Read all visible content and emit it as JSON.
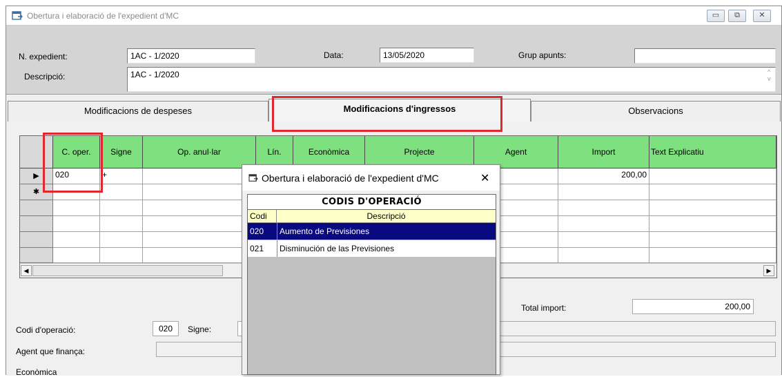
{
  "window": {
    "title": "Obertura i elaboració de l'expedient d'MC",
    "buttons": {
      "minimize": "▭",
      "restore": "⧉",
      "close": "✕"
    }
  },
  "header": {
    "expedient_label": "N. expedient:",
    "expedient_value": "1AC - 1/2020",
    "data_label": "Data:",
    "data_value": "13/05/2020",
    "grup_label": "Grup apunts:",
    "grup_value": "",
    "descripcio_label": "Descripció:",
    "descripcio_value": "1AC - 1/2020"
  },
  "tabs": [
    {
      "label": "Modificacions de despeses",
      "active": false
    },
    {
      "label": "Modificacions d'ingressos",
      "active": true
    },
    {
      "label": "Observacions",
      "active": false
    }
  ],
  "grid": {
    "columns": [
      "C. oper.",
      "Signe",
      "Op. anul·lar",
      "Lín.",
      "Econòmica",
      "Projecte",
      "Agent",
      "Import",
      "Text Explicatiu"
    ],
    "rows": [
      {
        "indicator": "▶",
        "c_oper": "020",
        "signe": "+",
        "import": "200,00"
      },
      {
        "indicator": "✱",
        "c_oper": "",
        "signe": "",
        "import": ""
      }
    ],
    "header_color": "#7ee07e"
  },
  "footer": {
    "total_label": "Total import:",
    "total_value": "200,00",
    "codi_label": "Codi d'operació:",
    "codi_value": "020",
    "signe_label": "Signe:",
    "agent_label": "Agent que finança:",
    "economica_label": "Econòmica"
  },
  "popup": {
    "title": "Obertura i elaboració de l'expedient d'MC",
    "close": "✕",
    "heading": "CODIS D'OPERACIÓ",
    "col_codi": "Codi",
    "col_desc": "Descripció",
    "items": [
      {
        "codi": "020",
        "desc": "Aumento de Previsiones",
        "selected": true
      },
      {
        "codi": "021",
        "desc": "Disminución de las Previsiones",
        "selected": false
      }
    ],
    "selected_color": "#0a0a80"
  },
  "highlight_color": "#e0282e"
}
